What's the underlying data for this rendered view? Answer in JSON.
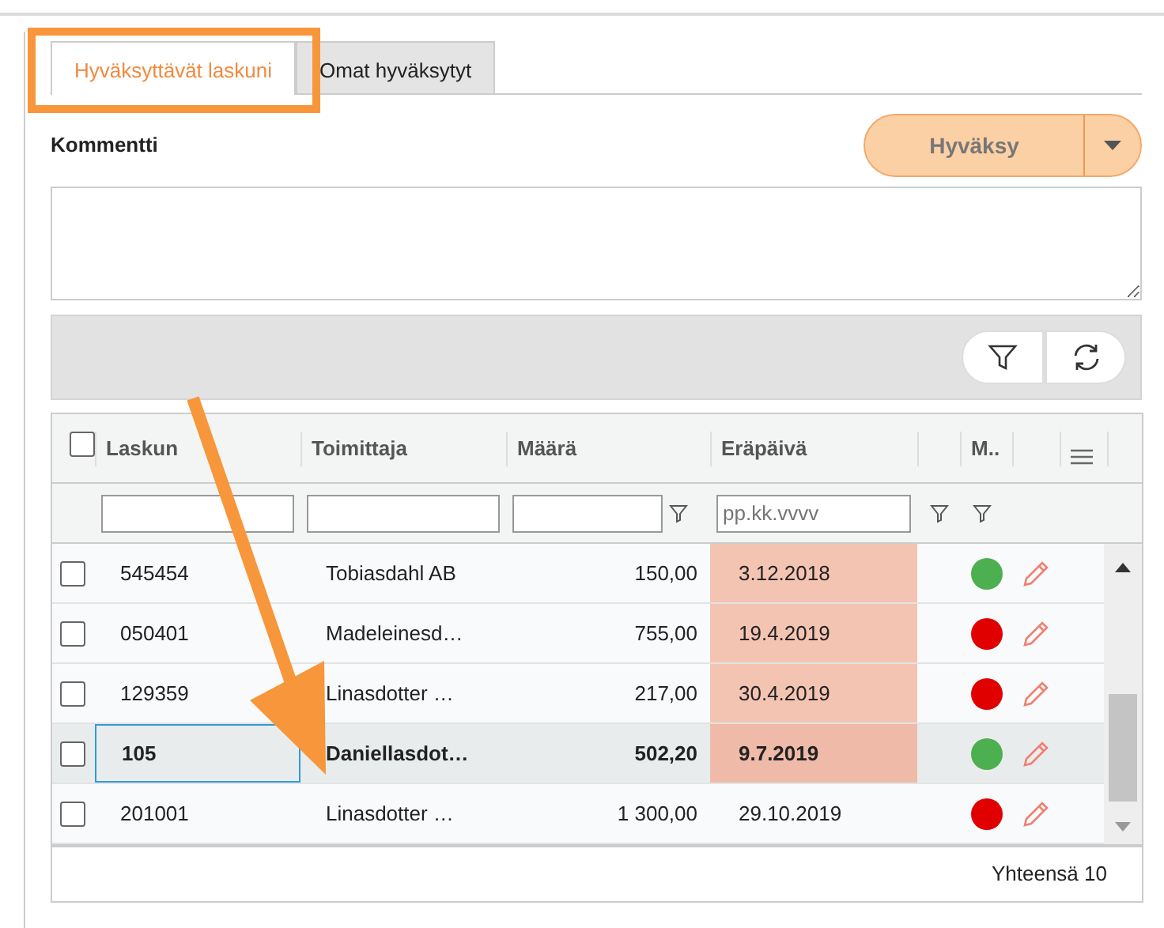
{
  "tabs": [
    {
      "label": "Hyväksyttävät laskuni",
      "selected": true
    },
    {
      "label": "Omat hyväksytyt",
      "selected": false
    }
  ],
  "comment": {
    "label": "Kommentti"
  },
  "approve_button": {
    "label": "Hyväksy"
  },
  "table": {
    "select_all": {
      "checked": false
    },
    "columns": [
      "Laskun",
      "Toimittaja",
      "Määrä",
      "Eräpäivä",
      "M.."
    ],
    "date_filter": {
      "placeholder": "pp.kk.vvvv"
    },
    "rows": [
      {
        "number": "545454",
        "supplier": "Tobiasdahl AB",
        "amount": "150,00",
        "due": "3.12.2018",
        "overdue": true,
        "color": "#4caf50",
        "selected": false,
        "checked": false
      },
      {
        "number": "050401",
        "supplier": "Madeleinesd…",
        "amount": "755,00",
        "due": "19.4.2019",
        "overdue": true,
        "color": "#e00000",
        "selected": false,
        "checked": false
      },
      {
        "number": "129359",
        "supplier": "Linasdotter …",
        "amount": "217,00",
        "due": "30.4.2019",
        "overdue": true,
        "color": "#e00000",
        "selected": false,
        "checked": false
      },
      {
        "number": "105",
        "supplier": "Daniellasdot…",
        "amount": "502,20",
        "due": "9.7.2019",
        "overdue": true,
        "color": "#4caf50",
        "selected": true,
        "checked": false
      },
      {
        "number": "201001",
        "supplier": "Linasdotter …",
        "amount": "1 300,00",
        "due": "29.10.2019",
        "overdue": false,
        "color": "#e00000",
        "selected": false,
        "checked": false
      }
    ],
    "footer": "Yhteensä 10"
  }
}
